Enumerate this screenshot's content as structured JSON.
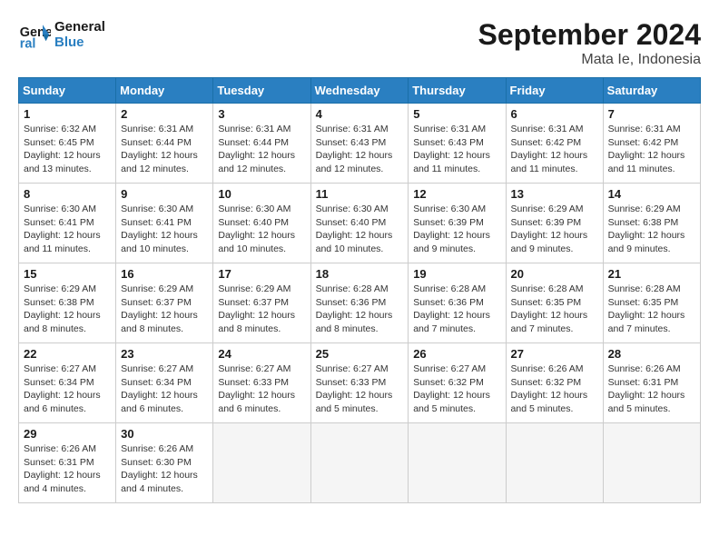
{
  "logo": {
    "line1": "General",
    "line2": "Blue"
  },
  "title": "September 2024",
  "location": "Mata Ie, Indonesia",
  "days_header": [
    "Sunday",
    "Monday",
    "Tuesday",
    "Wednesday",
    "Thursday",
    "Friday",
    "Saturday"
  ],
  "weeks": [
    [
      {
        "day": "1",
        "info": "Sunrise: 6:32 AM\nSunset: 6:45 PM\nDaylight: 12 hours\nand 13 minutes."
      },
      {
        "day": "2",
        "info": "Sunrise: 6:31 AM\nSunset: 6:44 PM\nDaylight: 12 hours\nand 12 minutes."
      },
      {
        "day": "3",
        "info": "Sunrise: 6:31 AM\nSunset: 6:44 PM\nDaylight: 12 hours\nand 12 minutes."
      },
      {
        "day": "4",
        "info": "Sunrise: 6:31 AM\nSunset: 6:43 PM\nDaylight: 12 hours\nand 12 minutes."
      },
      {
        "day": "5",
        "info": "Sunrise: 6:31 AM\nSunset: 6:43 PM\nDaylight: 12 hours\nand 11 minutes."
      },
      {
        "day": "6",
        "info": "Sunrise: 6:31 AM\nSunset: 6:42 PM\nDaylight: 12 hours\nand 11 minutes."
      },
      {
        "day": "7",
        "info": "Sunrise: 6:31 AM\nSunset: 6:42 PM\nDaylight: 12 hours\nand 11 minutes."
      }
    ],
    [
      {
        "day": "8",
        "info": "Sunrise: 6:30 AM\nSunset: 6:41 PM\nDaylight: 12 hours\nand 11 minutes."
      },
      {
        "day": "9",
        "info": "Sunrise: 6:30 AM\nSunset: 6:41 PM\nDaylight: 12 hours\nand 10 minutes."
      },
      {
        "day": "10",
        "info": "Sunrise: 6:30 AM\nSunset: 6:40 PM\nDaylight: 12 hours\nand 10 minutes."
      },
      {
        "day": "11",
        "info": "Sunrise: 6:30 AM\nSunset: 6:40 PM\nDaylight: 12 hours\nand 10 minutes."
      },
      {
        "day": "12",
        "info": "Sunrise: 6:30 AM\nSunset: 6:39 PM\nDaylight: 12 hours\nand 9 minutes."
      },
      {
        "day": "13",
        "info": "Sunrise: 6:29 AM\nSunset: 6:39 PM\nDaylight: 12 hours\nand 9 minutes."
      },
      {
        "day": "14",
        "info": "Sunrise: 6:29 AM\nSunset: 6:38 PM\nDaylight: 12 hours\nand 9 minutes."
      }
    ],
    [
      {
        "day": "15",
        "info": "Sunrise: 6:29 AM\nSunset: 6:38 PM\nDaylight: 12 hours\nand 8 minutes."
      },
      {
        "day": "16",
        "info": "Sunrise: 6:29 AM\nSunset: 6:37 PM\nDaylight: 12 hours\nand 8 minutes."
      },
      {
        "day": "17",
        "info": "Sunrise: 6:29 AM\nSunset: 6:37 PM\nDaylight: 12 hours\nand 8 minutes."
      },
      {
        "day": "18",
        "info": "Sunrise: 6:28 AM\nSunset: 6:36 PM\nDaylight: 12 hours\nand 8 minutes."
      },
      {
        "day": "19",
        "info": "Sunrise: 6:28 AM\nSunset: 6:36 PM\nDaylight: 12 hours\nand 7 minutes."
      },
      {
        "day": "20",
        "info": "Sunrise: 6:28 AM\nSunset: 6:35 PM\nDaylight: 12 hours\nand 7 minutes."
      },
      {
        "day": "21",
        "info": "Sunrise: 6:28 AM\nSunset: 6:35 PM\nDaylight: 12 hours\nand 7 minutes."
      }
    ],
    [
      {
        "day": "22",
        "info": "Sunrise: 6:27 AM\nSunset: 6:34 PM\nDaylight: 12 hours\nand 6 minutes."
      },
      {
        "day": "23",
        "info": "Sunrise: 6:27 AM\nSunset: 6:34 PM\nDaylight: 12 hours\nand 6 minutes."
      },
      {
        "day": "24",
        "info": "Sunrise: 6:27 AM\nSunset: 6:33 PM\nDaylight: 12 hours\nand 6 minutes."
      },
      {
        "day": "25",
        "info": "Sunrise: 6:27 AM\nSunset: 6:33 PM\nDaylight: 12 hours\nand 5 minutes."
      },
      {
        "day": "26",
        "info": "Sunrise: 6:27 AM\nSunset: 6:32 PM\nDaylight: 12 hours\nand 5 minutes."
      },
      {
        "day": "27",
        "info": "Sunrise: 6:26 AM\nSunset: 6:32 PM\nDaylight: 12 hours\nand 5 minutes."
      },
      {
        "day": "28",
        "info": "Sunrise: 6:26 AM\nSunset: 6:31 PM\nDaylight: 12 hours\nand 5 minutes."
      }
    ],
    [
      {
        "day": "29",
        "info": "Sunrise: 6:26 AM\nSunset: 6:31 PM\nDaylight: 12 hours\nand 4 minutes."
      },
      {
        "day": "30",
        "info": "Sunrise: 6:26 AM\nSunset: 6:30 PM\nDaylight: 12 hours\nand 4 minutes."
      },
      null,
      null,
      null,
      null,
      null
    ]
  ]
}
